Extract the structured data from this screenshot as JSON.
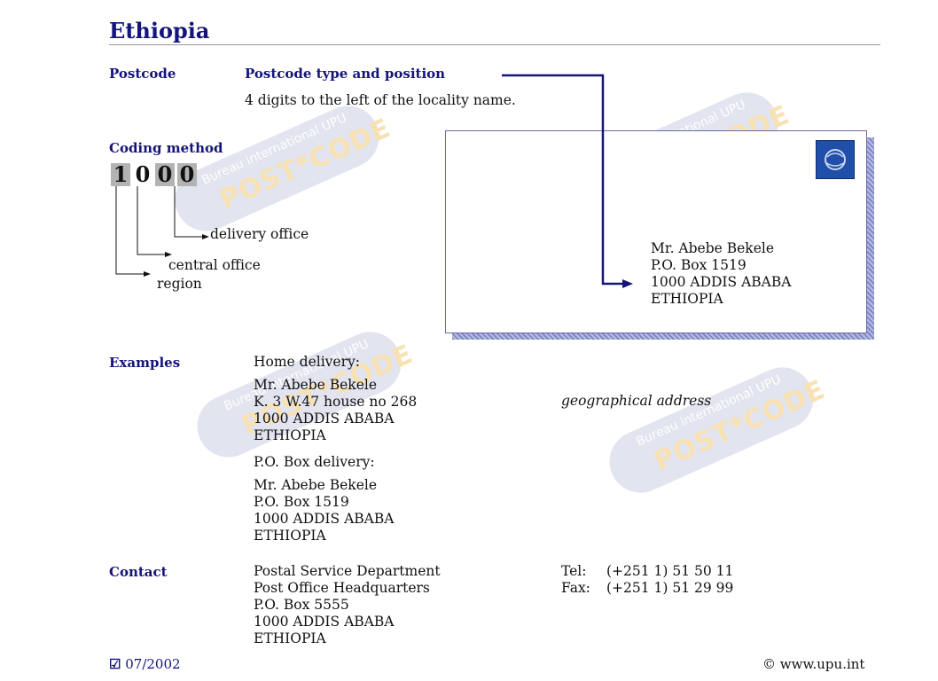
{
  "country": "Ethiopia",
  "postcode": {
    "label": "Postcode",
    "type_heading": "Postcode type and position",
    "description": "4 digits to the left of the locality name."
  },
  "coding": {
    "label": "Coding method",
    "digits": [
      "1",
      "0",
      "0",
      "0"
    ],
    "parts": {
      "delivery": "delivery office",
      "central": "central office",
      "region": "region"
    }
  },
  "envelope_address": [
    "Mr. Abebe Bekele",
    "P.O. Box 1519",
    "1000 ADDIS ABABA",
    "ETHIOPIA"
  ],
  "examples": {
    "label": "Examples",
    "home_heading": "Home delivery:",
    "home_lines": [
      "Mr. Abebe Bekele",
      "K. 3 W.47 house no 268",
      "1000 ADDIS ABABA",
      "ETHIOPIA"
    ],
    "geo_note": "geographical address",
    "pobox_heading": "P.O. Box delivery:",
    "pobox_lines": [
      "Mr. Abebe Bekele",
      "P.O. Box 1519",
      "1000 ADDIS ABABA",
      "ETHIOPIA"
    ]
  },
  "contact": {
    "label": "Contact",
    "lines": [
      "Postal Service Department",
      "Post Office Headquarters",
      "P.O. Box 5555",
      "1000 ADDIS ABABA",
      "ETHIOPIA"
    ],
    "tel_label": "Tel:",
    "tel": "(+251 1) 51 50 11",
    "fax_label": "Fax:",
    "fax": "(+251 1) 51 29 99"
  },
  "footer": {
    "checkbox_icon": "☑",
    "date": "07/2002",
    "copyright": "© www.upu.int"
  },
  "watermark": {
    "text": "Bureau international UPU",
    "logo": "POST*CODE"
  },
  "colors": {
    "heading": "#14147a",
    "arrow": "#14147a",
    "stamp": "#1f4fa8"
  }
}
